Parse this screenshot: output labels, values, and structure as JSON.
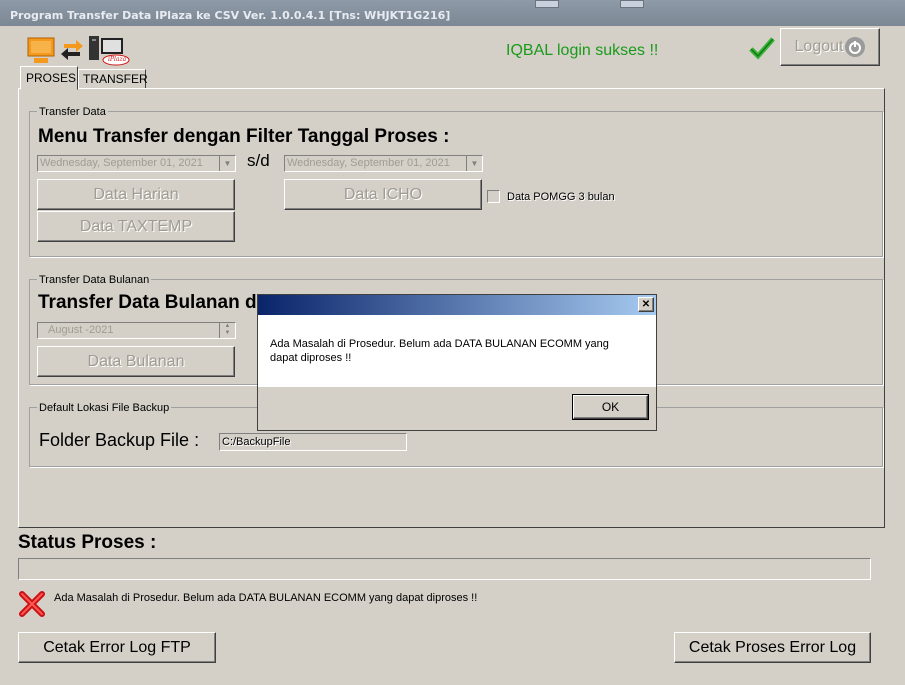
{
  "window": {
    "title": "Program Transfer Data IPlaza ke CSV Ver. 1.0.0.4.1 [Tns: WHJKT1G216]"
  },
  "header": {
    "login_message": "IQBAL login sukses !!",
    "logout_label": "Logout",
    "logo_badge": "iPlaza"
  },
  "tabs": [
    {
      "label": "PROSES"
    },
    {
      "label": "TRANSFER"
    }
  ],
  "transfer_data": {
    "group_label": "Transfer Data",
    "heading": "Menu Transfer dengan Filter Tanggal Proses :",
    "date_from": "Wednesday, September 01, 2021",
    "separator": "s/d",
    "date_to": "Wednesday, September 01, 2021",
    "btn_harian": "Data Harian",
    "btn_icho": "Data ICHO",
    "btn_taxtemp": "Data TAXTEMP",
    "pomgg_label": "Data POMGG 3 bulan"
  },
  "transfer_bulanan": {
    "group_label": "Transfer Data Bulanan",
    "heading": "Transfer Data Bulanan d",
    "month_value": "August   -2021",
    "btn_bulanan": "Data Bulanan"
  },
  "backup": {
    "group_label": "Default Lokasi File Backup",
    "label": "Folder Backup File :",
    "path": "C:/BackupFile"
  },
  "status": {
    "heading": "Status Proses :",
    "message": "Ada Masalah di Prosedur. Belum ada DATA BULANAN ECOMM yang dapat diproses !!"
  },
  "footer": {
    "btn_ftp": "Cetak Error Log FTP",
    "btn_proses": "Cetak Proses Error Log"
  },
  "dialog": {
    "message": "Ada Masalah di Prosedur. Belum ada DATA BULANAN ECOMM yang dapat diproses !!",
    "ok_label": "OK",
    "close_glyph": "✕"
  },
  "colors": {
    "login_green": "#1a9a1a",
    "error_red": "#cc1111",
    "dialog_title_start": "#0a246a",
    "dialog_title_end": "#a6caf0"
  }
}
